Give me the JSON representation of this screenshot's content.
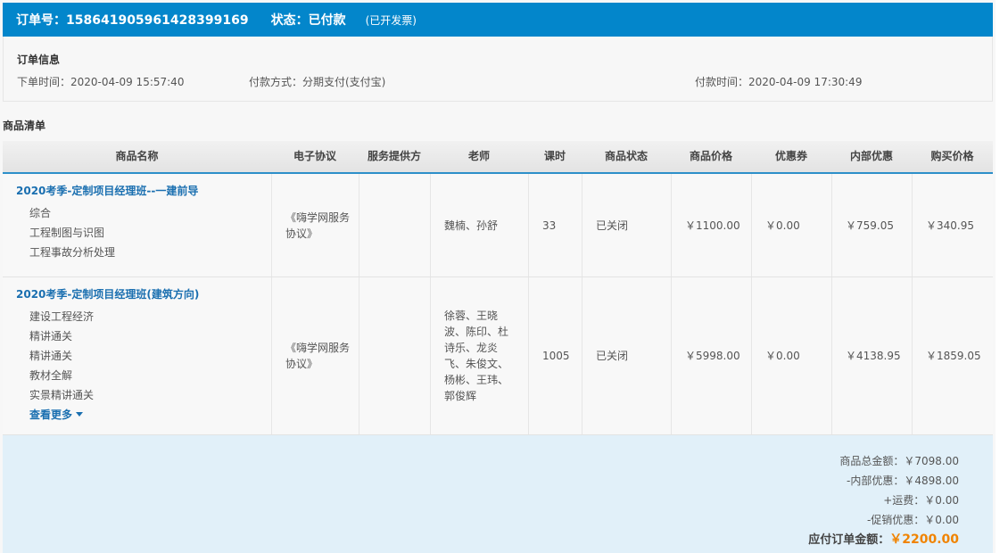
{
  "header": {
    "order_no": "订单号：158641905961428399169",
    "status": "状态：已付款",
    "invoice": "(已开发票)"
  },
  "order_info": {
    "title": "订单信息",
    "order_time": "下单时间：2020-04-09 15:57:40",
    "pay_method": "付款方式：分期支付(支付宝)",
    "pay_time": "付款时间：2020-04-09 17:30:49"
  },
  "list_title": "商品清单",
  "columns": [
    "商品名称",
    "电子协议",
    "服务提供方",
    "老师",
    "课时",
    "商品状态",
    "商品价格",
    "优惠券",
    "内部优惠",
    "购买价格"
  ],
  "rows": [
    {
      "course": "2020考季-定制项目经理班--一建前导",
      "subitems": [
        "综合",
        "工程制图与识图",
        "工程事故分析处理"
      ],
      "agreement": "《嗨学网服务协议》",
      "provider": "",
      "teachers": "魏楠、孙舒",
      "hours": "33",
      "status": "已关闭",
      "price": "￥1100.00",
      "coupon": "￥0.00",
      "internal": "￥759.05",
      "purchase": "￥340.95"
    },
    {
      "course": "2020考季-定制项目经理班(建筑方向)",
      "subitems": [
        "建设工程经济",
        "精讲通关",
        "精讲通关",
        "教材全解",
        "实景精讲通关"
      ],
      "more": "查看更多",
      "agreement": "《嗨学网服务协议》",
      "provider": "",
      "teachers": "徐蓉、王晓波、陈印、杜诗乐、龙炎飞、朱俊文、杨彬、王玮、郭俊辉",
      "hours": "1005",
      "status": "已关闭",
      "price": "￥5998.00",
      "coupon": "￥0.00",
      "internal": "￥4138.95",
      "purchase": "￥1859.05"
    }
  ],
  "summary": {
    "goods_total": "商品总金额：￥7098.00",
    "internal_discount": "-内部优惠：￥4898.00",
    "shipping": "+运费：￥0.00",
    "promo": "-促销优惠：￥0.00",
    "payable_label": "应付订单金额：",
    "payable_amount": "￥2200.00"
  },
  "colors": {
    "header_bg": "#0386cb",
    "link": "#1a6fb0",
    "amount": "#f08300"
  }
}
